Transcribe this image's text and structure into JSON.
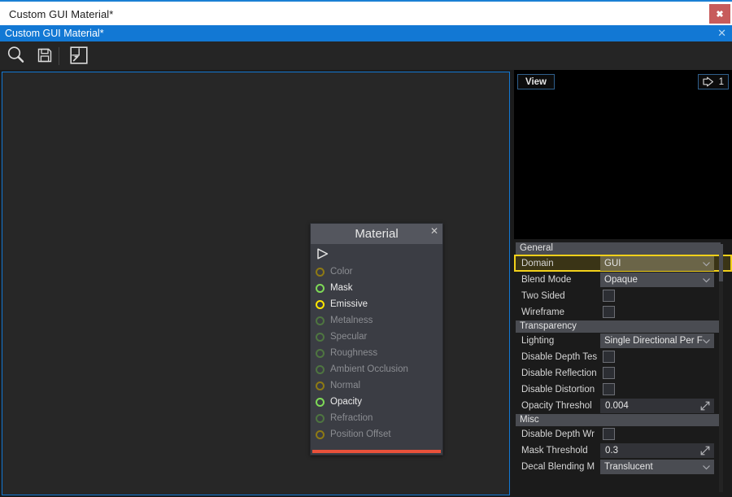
{
  "window": {
    "title": "Custom GUI Material*",
    "close_label": "✖"
  },
  "tab": {
    "label": "Custom GUI Material*",
    "close_label": "✕"
  },
  "toolbar": {
    "items": [
      {
        "name": "search-icon",
        "tooltip": "Search"
      },
      {
        "name": "save-icon",
        "tooltip": "Save"
      },
      {
        "name": "export-icon",
        "tooltip": "Export"
      }
    ]
  },
  "node": {
    "title": "Material",
    "close_label": "✕",
    "accent_color": "#e8513a",
    "ports": [
      {
        "label": "Color",
        "dot": "p-olive",
        "text": "l-dim"
      },
      {
        "label": "Mask",
        "dot": "p-green",
        "text": "l-on"
      },
      {
        "label": "Emissive",
        "dot": "p-yellow",
        "text": "l-on"
      },
      {
        "label": "Metalness",
        "dot": "p-green-dim",
        "text": "l-dim"
      },
      {
        "label": "Specular",
        "dot": "p-green-dim",
        "text": "l-dim"
      },
      {
        "label": "Roughness",
        "dot": "p-green-dim",
        "text": "l-dim"
      },
      {
        "label": "Ambient Occlusion",
        "dot": "p-green-dim",
        "text": "l-dim"
      },
      {
        "label": "Normal",
        "dot": "p-olive",
        "text": "l-dim"
      },
      {
        "label": "Opacity",
        "dot": "p-green",
        "text": "l-on"
      },
      {
        "label": "Refraction",
        "dot": "p-green-dim",
        "text": "l-dim"
      },
      {
        "label": "Position Offset",
        "dot": "p-olive",
        "text": "l-dim"
      }
    ]
  },
  "viewport": {
    "view_button": "View",
    "badge_count": "1",
    "badge_icon": "flag-arrow-icon"
  },
  "properties": {
    "sections": [
      {
        "title": "General",
        "rows": [
          {
            "label": "Domain",
            "type": "combo",
            "value": "GUI",
            "highlight": true
          },
          {
            "label": "Blend Mode",
            "type": "combo",
            "value": "Opaque"
          },
          {
            "label": "Two Sided",
            "type": "checkbox",
            "value": false
          },
          {
            "label": "Wireframe",
            "type": "checkbox",
            "value": false
          }
        ]
      },
      {
        "title": "Transparency",
        "rows": [
          {
            "label": "Lighting",
            "type": "combo",
            "value": "Single Directional Per F"
          },
          {
            "label": "Disable Depth Tes",
            "type": "checkbox",
            "value": false
          },
          {
            "label": "Disable Reflection",
            "type": "checkbox",
            "value": false
          },
          {
            "label": "Disable Distortion",
            "type": "checkbox",
            "value": false
          },
          {
            "label": "Opacity Threshol",
            "type": "number",
            "value": "0.004"
          }
        ]
      },
      {
        "title": "Misc",
        "rows": [
          {
            "label": "Disable Depth Wr",
            "type": "checkbox",
            "value": false
          },
          {
            "label": "Mask Threshold",
            "type": "number",
            "value": "0.3"
          },
          {
            "label": "Decal Blending M",
            "type": "combo",
            "value": "Translucent"
          }
        ]
      }
    ]
  }
}
